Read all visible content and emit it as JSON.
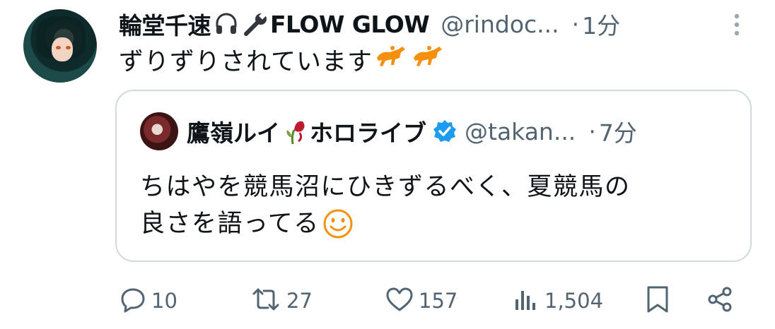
{
  "tweet": {
    "author_name": "輪堂千速",
    "author_name_suffix": "FLOW GLOW",
    "handle": "@rindoc...",
    "separator": "·",
    "time": "1分",
    "text": "ずりずりされています",
    "icons": [
      "headphones-icon",
      "wrench-icon",
      "horse-racing-icon",
      "horse-racing-icon",
      "more-vertical-icon"
    ]
  },
  "quote": {
    "author_name": "鷹嶺ルイ",
    "author_name_suffix": "ホロライブ",
    "handle": "@takan...",
    "separator": "·",
    "time": "7分",
    "text_line1": "ちはやを競馬沼にひきずるべく、夏競馬の",
    "text_line2": "良さを語ってる",
    "icons": [
      "wilted-rose-icon",
      "verified-badge-icon",
      "smiley-icon"
    ]
  },
  "actions": {
    "replies": "10",
    "reposts": "27",
    "likes": "157",
    "views": "1,504"
  },
  "colors": {
    "text": "#0f1419",
    "secondary": "#536471",
    "border": "#cfd9de",
    "verified": "#1d9bf0",
    "emoji_orange": "#f4900c"
  }
}
